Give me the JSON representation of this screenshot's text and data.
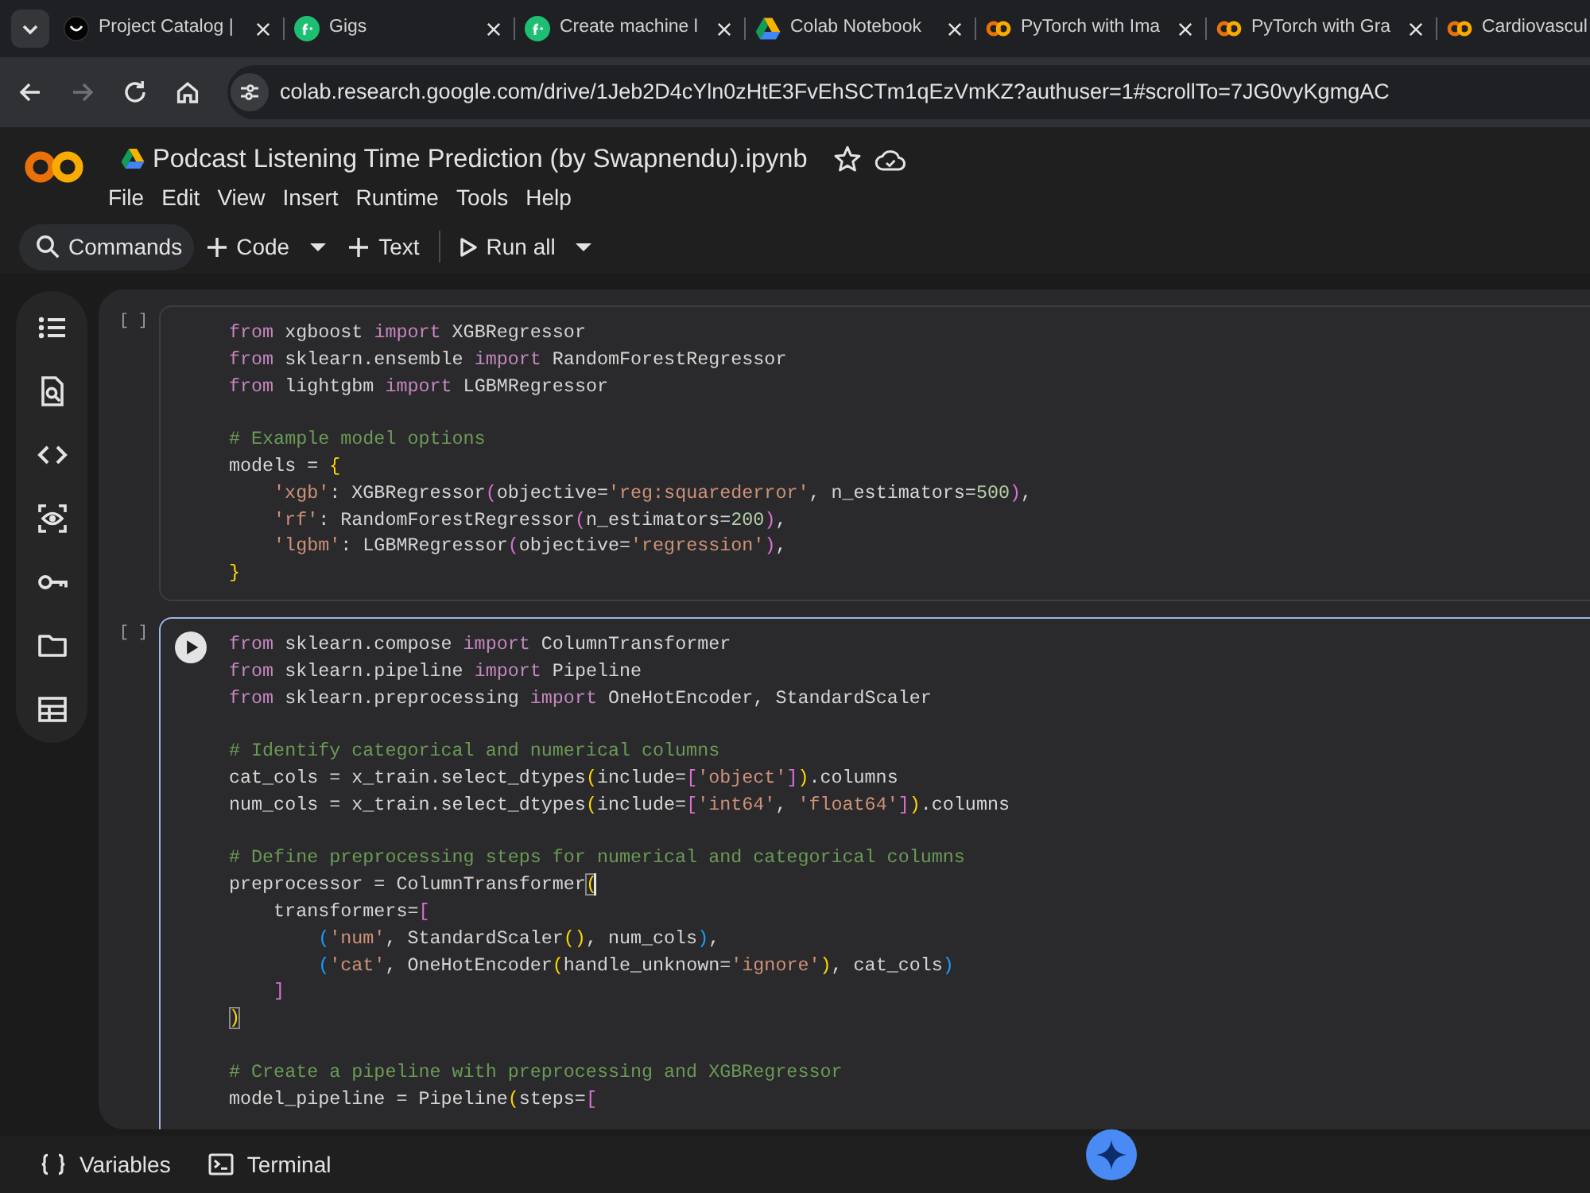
{
  "browser": {
    "tabs": [
      {
        "title": "Project Catalog |",
        "kind": "monogram",
        "selected": false,
        "closable": true
      },
      {
        "title": "Gigs",
        "kind": "roundel",
        "selected": false,
        "closable": true
      },
      {
        "title": "Create machine l",
        "kind": "roundel",
        "selected": false,
        "closable": true
      },
      {
        "title": "Colab Notebook",
        "kind": "triangle",
        "selected": false,
        "closable": true
      },
      {
        "title": "PyTorch with Ima",
        "kind": "rings",
        "selected": false,
        "closable": true
      },
      {
        "title": "PyTorch with Gra",
        "kind": "rings",
        "selected": false,
        "closable": true
      },
      {
        "title": "Cardiovascul",
        "kind": "rings",
        "selected": false,
        "closable": false
      }
    ],
    "nav_buttons": [
      {
        "kind": "back",
        "disabled": false
      },
      {
        "kind": "forward",
        "disabled": true
      },
      {
        "kind": "reload",
        "disabled": false
      },
      {
        "kind": "home",
        "disabled": false
      }
    ],
    "address": "colab.research.google.com/drive/1Jeb2D4cYln0zHtE3FvEhSCTm1qEzVmKZ?authuser=1#scrollTo=7JG0vyKgmgAC"
  },
  "notebook": {
    "title": "Podcast Listening Time Prediction (by Swapnendu).ipynb",
    "menu": [
      "File",
      "Edit",
      "View",
      "Insert",
      "Runtime",
      "Tools",
      "Help"
    ],
    "toolbar": [
      {
        "kind": "search",
        "label": "Commands",
        "dropdown": false
      },
      {
        "kind": "add",
        "label": "Code",
        "dropdown": true
      },
      {
        "kind": "add",
        "label": "Text",
        "dropdown": false
      },
      {
        "kind": "run",
        "label": "Run all",
        "dropdown": true
      }
    ],
    "cells": [
      {
        "count": "[ ]",
        "focused": false,
        "blocks": [
          {
            "lines": [
              {
                "tokens": [
                  {
                    "kind": "keyword",
                    "text": "from"
                  },
                  {
                    "kind": "plain",
                    "text": " xgboost "
                  },
                  {
                    "kind": "keyword",
                    "text": "import"
                  },
                  {
                    "kind": "plain",
                    "text": " XGBRegressor"
                  }
                ]
              },
              {
                "tokens": [
                  {
                    "kind": "keyword",
                    "text": "from"
                  },
                  {
                    "kind": "plain",
                    "text": " sklearn.ensemble "
                  },
                  {
                    "kind": "keyword",
                    "text": "import"
                  },
                  {
                    "kind": "plain",
                    "text": " RandomForestRegressor"
                  }
                ]
              },
              {
                "tokens": [
                  {
                    "kind": "keyword",
                    "text": "from"
                  },
                  {
                    "kind": "plain",
                    "text": " lightgbm "
                  },
                  {
                    "kind": "keyword",
                    "text": "import"
                  },
                  {
                    "kind": "plain",
                    "text": " LGBMRegressor"
                  }
                ]
              }
            ]
          },
          {
            "lines": [
              {
                "tokens": [
                  {
                    "kind": "comment",
                    "text": "# Example model options"
                  }
                ]
              },
              {
                "tokens": [
                  {
                    "kind": "plain",
                    "text": "models = "
                  },
                  {
                    "kind": "bracket",
                    "text": "{",
                    "color": "#ffd700",
                    "matched": false,
                    "cursor": false
                  }
                ]
              },
              {
                "tokens": [
                  {
                    "kind": "string",
                    "text": "    'xgb'"
                  },
                  {
                    "kind": "plain",
                    "text": ": XGBRegressor"
                  },
                  {
                    "kind": "bracket",
                    "text": "(",
                    "color": "#da70d6",
                    "matched": false,
                    "cursor": false
                  },
                  {
                    "kind": "plain",
                    "text": "objective="
                  },
                  {
                    "kind": "string",
                    "text": "'reg:squarederror'"
                  },
                  {
                    "kind": "plain",
                    "text": ", n_estimators="
                  },
                  {
                    "kind": "number",
                    "text": "500"
                  },
                  {
                    "kind": "bracket",
                    "text": ")",
                    "color": "#da70d6",
                    "matched": false,
                    "cursor": false
                  },
                  {
                    "kind": "plain",
                    "text": ","
                  }
                ]
              },
              {
                "tokens": [
                  {
                    "kind": "string",
                    "text": "    'rf'"
                  },
                  {
                    "kind": "plain",
                    "text": ": RandomForestRegressor"
                  },
                  {
                    "kind": "bracket",
                    "text": "(",
                    "color": "#da70d6",
                    "matched": false,
                    "cursor": false
                  },
                  {
                    "kind": "plain",
                    "text": "n_estimators="
                  },
                  {
                    "kind": "number",
                    "text": "200"
                  },
                  {
                    "kind": "bracket",
                    "text": ")",
                    "color": "#da70d6",
                    "matched": false,
                    "cursor": false
                  },
                  {
                    "kind": "plain",
                    "text": ","
                  }
                ]
              },
              {
                "tokens": [
                  {
                    "kind": "string",
                    "text": "    'lgbm'"
                  },
                  {
                    "kind": "plain",
                    "text": ": LGBMRegressor"
                  },
                  {
                    "kind": "bracket",
                    "text": "(",
                    "color": "#da70d6",
                    "matched": false,
                    "cursor": false
                  },
                  {
                    "kind": "plain",
                    "text": "objective="
                  },
                  {
                    "kind": "string",
                    "text": "'regression'"
                  },
                  {
                    "kind": "bracket",
                    "text": ")",
                    "color": "#da70d6",
                    "matched": false,
                    "cursor": false
                  },
                  {
                    "kind": "plain",
                    "text": ","
                  }
                ]
              },
              {
                "tokens": [
                  {
                    "kind": "bracket",
                    "text": "}",
                    "color": "#ffd700",
                    "matched": false,
                    "cursor": false
                  }
                ]
              }
            ]
          }
        ]
      },
      {
        "count": "[ ]",
        "focused": true,
        "blocks": [
          {
            "lines": [
              {
                "tokens": [
                  {
                    "kind": "keyword",
                    "text": "from"
                  },
                  {
                    "kind": "plain",
                    "text": " sklearn.compose "
                  },
                  {
                    "kind": "keyword",
                    "text": "import"
                  },
                  {
                    "kind": "plain",
                    "text": " ColumnTransformer"
                  }
                ]
              },
              {
                "tokens": [
                  {
                    "kind": "keyword",
                    "text": "from"
                  },
                  {
                    "kind": "plain",
                    "text": " sklearn.pipeline "
                  },
                  {
                    "kind": "keyword",
                    "text": "import"
                  },
                  {
                    "kind": "plain",
                    "text": " Pipeline"
                  }
                ]
              },
              {
                "tokens": [
                  {
                    "kind": "keyword",
                    "text": "from"
                  },
                  {
                    "kind": "plain",
                    "text": " sklearn.preprocessing "
                  },
                  {
                    "kind": "keyword",
                    "text": "import"
                  },
                  {
                    "kind": "plain",
                    "text": " OneHotEncoder, StandardScaler"
                  }
                ]
              }
            ]
          },
          {
            "lines": [
              {
                "tokens": [
                  {
                    "kind": "comment",
                    "text": "# Identify categorical and numerical columns"
                  }
                ]
              },
              {
                "tokens": [
                  {
                    "kind": "plain",
                    "text": "cat_cols = x_train.select_dtypes"
                  },
                  {
                    "kind": "bracket",
                    "text": "(",
                    "color": "#ffd700",
                    "matched": false,
                    "cursor": false
                  },
                  {
                    "kind": "plain",
                    "text": "include="
                  },
                  {
                    "kind": "bracket",
                    "text": "[",
                    "color": "#da70d6",
                    "matched": false,
                    "cursor": false
                  },
                  {
                    "kind": "string",
                    "text": "'object'"
                  },
                  {
                    "kind": "bracket",
                    "text": "]",
                    "color": "#da70d6",
                    "matched": false,
                    "cursor": false
                  },
                  {
                    "kind": "bracket",
                    "text": ")",
                    "color": "#ffd700",
                    "matched": false,
                    "cursor": false
                  },
                  {
                    "kind": "plain",
                    "text": ".columns"
                  }
                ]
              },
              {
                "tokens": [
                  {
                    "kind": "plain",
                    "text": "num_cols = x_train.select_dtypes"
                  },
                  {
                    "kind": "bracket",
                    "text": "(",
                    "color": "#ffd700",
                    "matched": false,
                    "cursor": false
                  },
                  {
                    "kind": "plain",
                    "text": "include="
                  },
                  {
                    "kind": "bracket",
                    "text": "[",
                    "color": "#da70d6",
                    "matched": false,
                    "cursor": false
                  },
                  {
                    "kind": "string",
                    "text": "'int64'"
                  },
                  {
                    "kind": "plain",
                    "text": ", "
                  },
                  {
                    "kind": "string",
                    "text": "'float64'"
                  },
                  {
                    "kind": "bracket",
                    "text": "]",
                    "color": "#da70d6",
                    "matched": false,
                    "cursor": false
                  },
                  {
                    "kind": "bracket",
                    "text": ")",
                    "color": "#ffd700",
                    "matched": false,
                    "cursor": false
                  },
                  {
                    "kind": "plain",
                    "text": ".columns"
                  }
                ]
              }
            ]
          },
          {
            "lines": [
              {
                "tokens": [
                  {
                    "kind": "comment",
                    "text": "# Define preprocessing steps for numerical and categorical columns"
                  }
                ]
              },
              {
                "tokens": [
                  {
                    "kind": "plain",
                    "text": "preprocessor = ColumnTransformer"
                  },
                  {
                    "kind": "bracket",
                    "text": "(",
                    "color": "#ffd700",
                    "matched": true,
                    "cursor": true
                  }
                ]
              },
              {
                "tokens": [
                  {
                    "kind": "plain",
                    "text": "    transformers="
                  },
                  {
                    "kind": "bracket",
                    "text": "[",
                    "color": "#da70d6",
                    "matched": false,
                    "cursor": false
                  }
                ]
              },
              {
                "tokens": [
                  {
                    "kind": "bracket",
                    "text": "        (",
                    "color": "#179fff",
                    "matched": false,
                    "cursor": false
                  },
                  {
                    "kind": "string",
                    "text": "'num'"
                  },
                  {
                    "kind": "plain",
                    "text": ", StandardScaler"
                  },
                  {
                    "kind": "bracket",
                    "text": "(",
                    "color": "#ffd700",
                    "matched": false,
                    "cursor": false
                  },
                  {
                    "kind": "bracket",
                    "text": ")",
                    "color": "#ffd700",
                    "matched": false,
                    "cursor": false
                  },
                  {
                    "kind": "plain",
                    "text": ", num_cols"
                  },
                  {
                    "kind": "bracket",
                    "text": ")",
                    "color": "#179fff",
                    "matched": false,
                    "cursor": false
                  },
                  {
                    "kind": "plain",
                    "text": ","
                  }
                ]
              },
              {
                "tokens": [
                  {
                    "kind": "bracket",
                    "text": "        (",
                    "color": "#179fff",
                    "matched": false,
                    "cursor": false
                  },
                  {
                    "kind": "string",
                    "text": "'cat'"
                  },
                  {
                    "kind": "plain",
                    "text": ", OneHotEncoder"
                  },
                  {
                    "kind": "bracket",
                    "text": "(",
                    "color": "#ffd700",
                    "matched": false,
                    "cursor": false
                  },
                  {
                    "kind": "plain",
                    "text": "handle_unknown="
                  },
                  {
                    "kind": "string",
                    "text": "'ignore'"
                  },
                  {
                    "kind": "bracket",
                    "text": ")",
                    "color": "#ffd700",
                    "matched": false,
                    "cursor": false
                  },
                  {
                    "kind": "plain",
                    "text": ", cat_cols"
                  },
                  {
                    "kind": "bracket",
                    "text": ")",
                    "color": "#179fff",
                    "matched": false,
                    "cursor": false
                  }
                ]
              },
              {
                "tokens": [
                  {
                    "kind": "bracket",
                    "text": "    ]",
                    "color": "#da70d6",
                    "matched": false,
                    "cursor": false
                  }
                ]
              },
              {
                "tokens": [
                  {
                    "kind": "bracket",
                    "text": ")",
                    "color": "#ffd700",
                    "matched": true,
                    "cursor": false
                  }
                ]
              }
            ]
          },
          {
            "lines": [
              {
                "tokens": [
                  {
                    "kind": "comment",
                    "text": "# Create a pipeline with preprocessing and XGBRegressor"
                  }
                ]
              },
              {
                "tokens": [
                  {
                    "kind": "plain",
                    "text": "model_pipeline = Pipeline"
                  },
                  {
                    "kind": "bracket",
                    "text": "(",
                    "color": "#ffd700",
                    "matched": false,
                    "cursor": false
                  },
                  {
                    "kind": "plain",
                    "text": "steps="
                  },
                  {
                    "kind": "bracket",
                    "text": "[",
                    "color": "#da70d6",
                    "matched": false,
                    "cursor": false
                  }
                ]
              }
            ]
          }
        ]
      }
    ]
  },
  "status_bar": [
    {
      "kind": "variables",
      "label": "Variables"
    },
    {
      "kind": "terminal",
      "label": "Terminal"
    }
  ]
}
